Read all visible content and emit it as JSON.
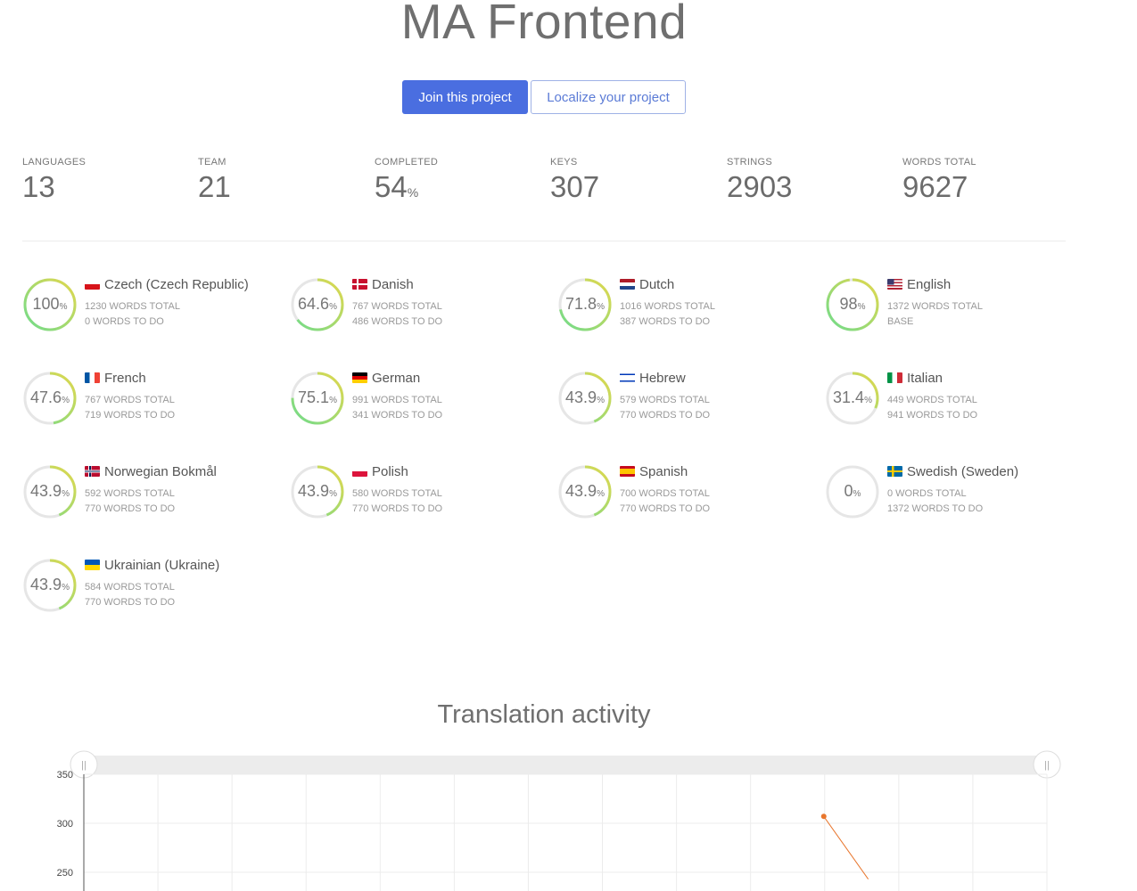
{
  "project": {
    "title": "MA Frontend"
  },
  "actions": {
    "join_label": "Join this project",
    "localize_label": "Localize your project"
  },
  "stats": [
    {
      "label": "LANGUAGES",
      "value": "13",
      "unit": ""
    },
    {
      "label": "TEAM",
      "value": "21",
      "unit": ""
    },
    {
      "label": "COMPLETED",
      "value": "54",
      "unit": "%"
    },
    {
      "label": "KEYS",
      "value": "307",
      "unit": ""
    },
    {
      "label": "STRINGS",
      "value": "2903",
      "unit": ""
    },
    {
      "label": "WORDS TOTAL",
      "value": "9627",
      "unit": ""
    }
  ],
  "languages": [
    {
      "name": "Czech (Czech Republic)",
      "flag": "cz",
      "percent": "100",
      "progress": 1.0,
      "words_total": "1230 WORDS TOTAL",
      "words_todo": "0 WORDS TO DO"
    },
    {
      "name": "Danish",
      "flag": "dk",
      "percent": "64.6",
      "progress": 0.646,
      "words_total": "767 WORDS TOTAL",
      "words_todo": "486 WORDS TO DO"
    },
    {
      "name": "Dutch",
      "flag": "nl",
      "percent": "71.8",
      "progress": 0.718,
      "words_total": "1016 WORDS TOTAL",
      "words_todo": "387 WORDS TO DO"
    },
    {
      "name": "English",
      "flag": "us",
      "percent": "98",
      "progress": 0.98,
      "words_total": "1372 WORDS TOTAL",
      "words_todo": "BASE"
    },
    {
      "name": "French",
      "flag": "fr",
      "percent": "47.6",
      "progress": 0.476,
      "words_total": "767 WORDS TOTAL",
      "words_todo": "719 WORDS TO DO"
    },
    {
      "name": "German",
      "flag": "de",
      "percent": "75.1",
      "progress": 0.751,
      "words_total": "991 WORDS TOTAL",
      "words_todo": "341 WORDS TO DO"
    },
    {
      "name": "Hebrew",
      "flag": "il",
      "percent": "43.9",
      "progress": 0.439,
      "words_total": "579 WORDS TOTAL",
      "words_todo": "770 WORDS TO DO"
    },
    {
      "name": "Italian",
      "flag": "it",
      "percent": "31.4",
      "progress": 0.314,
      "words_total": "449 WORDS TOTAL",
      "words_todo": "941 WORDS TO DO"
    },
    {
      "name": "Norwegian Bokmål",
      "flag": "no",
      "percent": "43.9",
      "progress": 0.439,
      "words_total": "592 WORDS TOTAL",
      "words_todo": "770 WORDS TO DO"
    },
    {
      "name": "Polish",
      "flag": "pl",
      "percent": "43.9",
      "progress": 0.439,
      "words_total": "580 WORDS TOTAL",
      "words_todo": "770 WORDS TO DO"
    },
    {
      "name": "Spanish",
      "flag": "es",
      "percent": "43.9",
      "progress": 0.439,
      "words_total": "700 WORDS TOTAL",
      "words_todo": "770 WORDS TO DO"
    },
    {
      "name": "Swedish (Sweden)",
      "flag": "se",
      "percent": "0",
      "progress": 0.0,
      "words_total": "0 WORDS TOTAL",
      "words_todo": "1372 WORDS TO DO"
    },
    {
      "name": "Ukrainian (Ukraine)",
      "flag": "ua",
      "percent": "43.9",
      "progress": 0.439,
      "words_total": "584 WORDS TOTAL",
      "words_todo": "770 WORDS TO DO"
    }
  ],
  "activity": {
    "title": "Translation activity",
    "percent_sign": "%"
  },
  "chart_data": {
    "type": "line",
    "title": "Translation activity",
    "y_ticks": [
      350,
      300,
      250
    ],
    "ylim_visible": [
      250,
      350
    ],
    "grid": true,
    "series": [
      {
        "color": "#e8762d",
        "points": [
          {
            "x_index": 10,
            "y": 307
          },
          {
            "x_index": 10.6,
            "y": 243
          }
        ]
      }
    ],
    "x_gridlines": 13,
    "range_slider": true
  },
  "colors": {
    "accent": "#4a6ee0",
    "ring_track": "#e6e6e6",
    "ring_start": "#6edc8c",
    "ring_end": "#e3d84c",
    "line": "#e8762d"
  }
}
